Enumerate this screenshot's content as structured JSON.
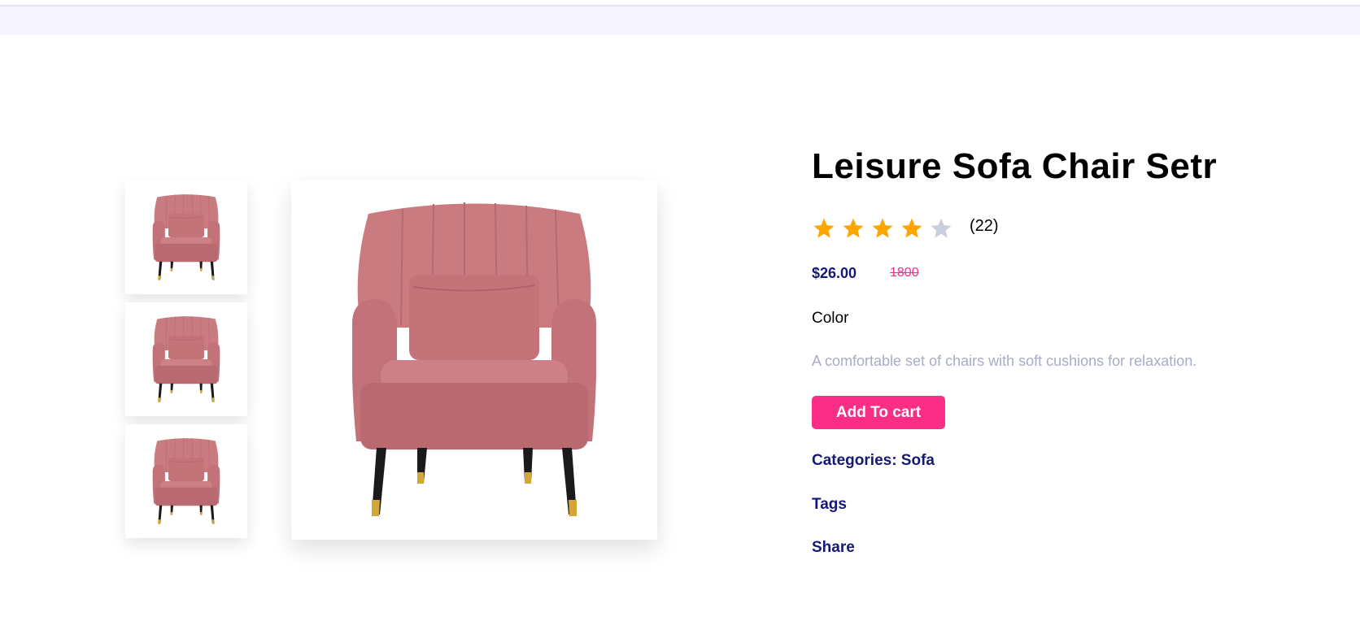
{
  "product": {
    "title": "Leisure Sofa Chair Setr",
    "rating": 4,
    "rating_max": 5,
    "review_count": "(22)",
    "price": "$26.00",
    "old_price": "1800",
    "color_label": "Color",
    "description": "A comfortable set of chairs with soft cushions for relaxation.",
    "add_to_cart_label": "Add To cart",
    "categories_label": "Categories: Sofa",
    "tags_label": "Tags",
    "share_label": "Share"
  },
  "colors": {
    "accent": "#fb2e86",
    "navy": "#151875",
    "star_filled": "#ffa500",
    "star_empty": "#c8cfde",
    "chair_body": "#c97b80",
    "chair_shade": "#b86a70",
    "leg": "#1a1a1a",
    "leg_tip": "#d4a63a"
  },
  "icons": {
    "star": "star-icon",
    "chair": "pink-armchair-image"
  }
}
